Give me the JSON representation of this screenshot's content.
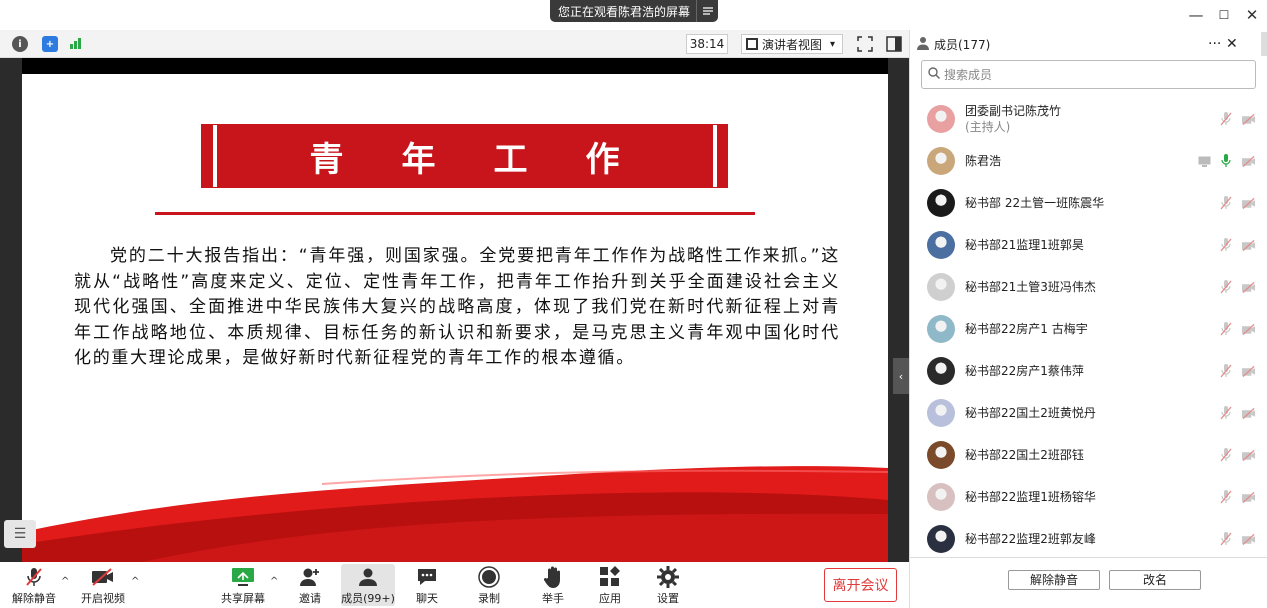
{
  "banner": {
    "text": "您正在观看陈君浩的屏幕",
    "menu_icon": "list-icon"
  },
  "window_controls": {
    "minimize": "—",
    "maximize": "☐",
    "close": "✕"
  },
  "topbar": {
    "timer": "38:14",
    "view_label": "演讲者视图",
    "view_caret": "▾"
  },
  "slide": {
    "title": "青年工作",
    "paragraph": "党的二十大报告指出：“青年强，则国家强。全党要把青年工作作为战略性工作来抓。”这就从“战略性”高度来定义、定位、定性青年工作，把青年工作抬升到关乎全面建设社会主义现代化强国、全面推进中华民族伟大复兴的战略高度，体现了我们党在新时代新征程上对青年工作战略地位、本质规律、目标任务的新认识和新要求，是马克思主义青年观中国化时代化的重大理论成果，是做好新时代新征程党的青年工作的根本遵循。"
  },
  "toolbar": {
    "unmute": "解除静音",
    "start_video": "开启视频",
    "share": "共享屏幕",
    "invite": "邀请",
    "members": "成员(99+)",
    "chat": "聊天",
    "record": "录制",
    "raise_hand": "举手",
    "apps": "应用",
    "settings": "设置",
    "leave": "离开会议"
  },
  "panel": {
    "title": "成员(177)",
    "more": "···",
    "close": "✕",
    "search_placeholder": "搜索成员",
    "members": [
      {
        "name": "团委副书记陈茂竹",
        "sub": "(主持人)",
        "color": "#e8a0a0"
      },
      {
        "name": "陈君浩",
        "sub": "",
        "color": "#c9a77a"
      },
      {
        "name": "秘书部 22土管一班陈震华",
        "sub": "",
        "color": "#1a1a1a"
      },
      {
        "name": "秘书部21监理1班郭昊",
        "sub": "",
        "color": "#4a6fa0"
      },
      {
        "name": "秘书部21土管3班冯伟杰",
        "sub": "",
        "color": "#cfcfcf"
      },
      {
        "name": "秘书部22房产1 古梅宇",
        "sub": "",
        "color": "#8fb8c8"
      },
      {
        "name": "秘书部22房产1蔡伟萍",
        "sub": "",
        "color": "#2a2a2a"
      },
      {
        "name": "秘书部22国土2班黄悦丹",
        "sub": "",
        "color": "#b8c0dc"
      },
      {
        "name": "秘书部22国土2班邵钰",
        "sub": "",
        "color": "#7a4a2a"
      },
      {
        "name": "秘书部22监理1班杨镕华",
        "sub": "",
        "color": "#d8c0c0"
      },
      {
        "name": "秘书部22监理2班郭友峰",
        "sub": "",
        "color": "#2a3040"
      }
    ],
    "mute_all": "解除静音",
    "rename": "改名"
  }
}
